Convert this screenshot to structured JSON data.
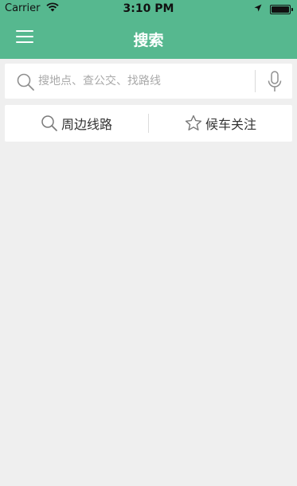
{
  "status_bar": {
    "carrier": "Carrier",
    "time": "3:10 PM"
  },
  "header": {
    "title": "搜索",
    "background_color": "#56b88f"
  },
  "search": {
    "placeholder": "搜地点、查公交、找路线",
    "value": ""
  },
  "actions": {
    "nearby_label": "周边线路",
    "follow_label": "候车关注"
  },
  "icons": {
    "menu": "hamburger-icon",
    "search": "search-icon",
    "mic": "microphone-icon",
    "star": "star-icon",
    "wifi": "wifi-icon",
    "location": "location-arrow-icon",
    "battery": "battery-icon"
  },
  "colors": {
    "accent": "#56b88f",
    "page_background": "#efefef"
  }
}
